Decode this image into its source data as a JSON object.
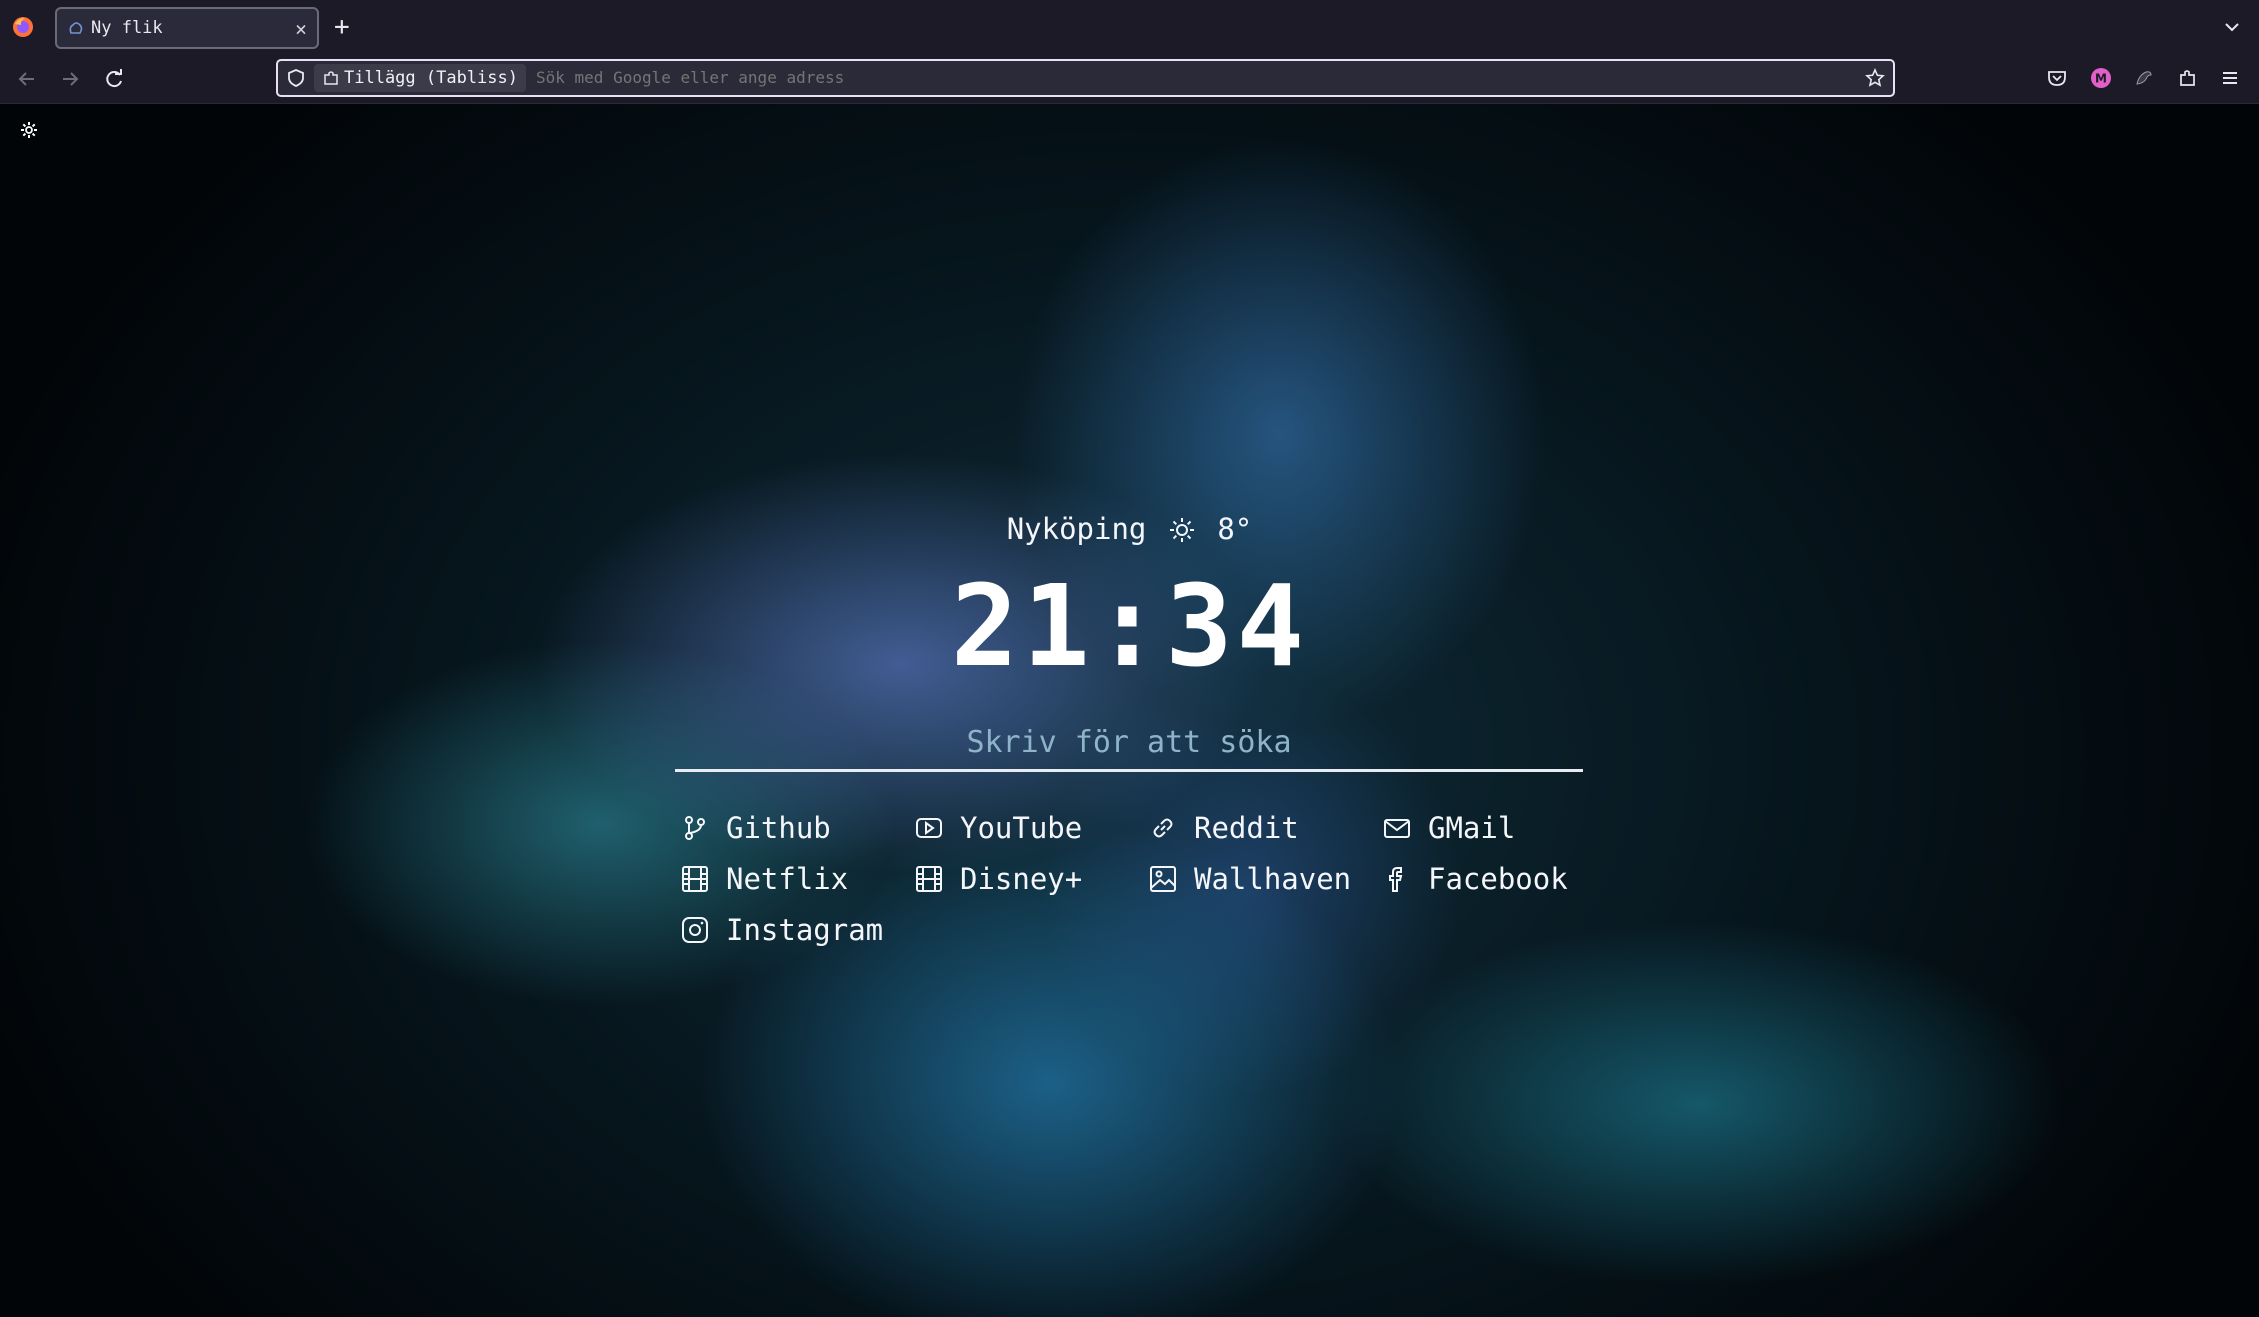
{
  "browser": {
    "tab": {
      "title": "Ny flik"
    },
    "urlbar": {
      "chip_label": "Tillägg (Tabliss)",
      "placeholder": "Sök med Google eller ange adress"
    }
  },
  "icons": {
    "firefox": "firefox-logo-icon",
    "new_tab": "plus-icon",
    "back": "back-arrow-icon",
    "forward": "forward-arrow-icon",
    "reload": "reload-icon",
    "shield": "shield-icon",
    "bookmark": "star-icon",
    "pocket": "pocket-icon",
    "account": "account-icon",
    "extension_bird": "bird-icon",
    "extensions": "puzzle-icon",
    "menu": "hamburger-menu-icon",
    "settings": "gear-icon"
  },
  "colors": {
    "chrome_bg": "#1b1a26",
    "urlbar_bg": "#2b2a38",
    "text": "#f4f6fa",
    "account_badge": "#e060c8"
  },
  "newtab": {
    "weather": {
      "city": "Nyköping",
      "temperature": "8°",
      "icon": "sun-icon"
    },
    "clock": "21:34",
    "search_placeholder": "Skriv för att söka",
    "links": [
      {
        "label": "Github",
        "icon": "github-branch-icon"
      },
      {
        "label": "YouTube",
        "icon": "youtube-icon"
      },
      {
        "label": "Reddit",
        "icon": "link-icon"
      },
      {
        "label": "GMail",
        "icon": "mail-icon"
      },
      {
        "label": "Netflix",
        "icon": "film-icon"
      },
      {
        "label": "Disney+",
        "icon": "film-icon"
      },
      {
        "label": "Wallhaven",
        "icon": "image-icon"
      },
      {
        "label": "Facebook",
        "icon": "facebook-icon"
      },
      {
        "label": "Instagram",
        "icon": "instagram-icon"
      }
    ]
  }
}
